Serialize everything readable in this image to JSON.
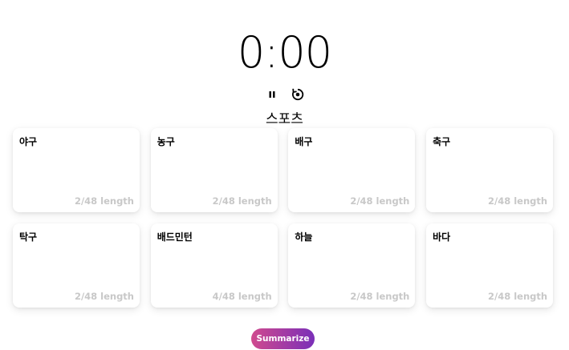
{
  "timer": {
    "display": "0:00"
  },
  "controls": {
    "pause_icon": "pause-icon",
    "reset_icon": "restart-icon"
  },
  "section_title": "스포츠",
  "cards": [
    {
      "label": "야구",
      "length": "2/48 length"
    },
    {
      "label": "농구",
      "length": "2/48 length"
    },
    {
      "label": "배구",
      "length": "2/48 length"
    },
    {
      "label": "축구",
      "length": "2/48 length"
    },
    {
      "label": "탁구",
      "length": "2/48 length"
    },
    {
      "label": "배드민턴",
      "length": "4/48 length"
    },
    {
      "label": "하늘",
      "length": "2/48 length"
    },
    {
      "label": "바다",
      "length": "2/48 length"
    }
  ],
  "actions": {
    "summarize_label": "Summarize"
  },
  "colors": {
    "gradient_start": "#d04a8e",
    "gradient_end": "#7a2fb8",
    "length_text": "#c8c8c8"
  }
}
